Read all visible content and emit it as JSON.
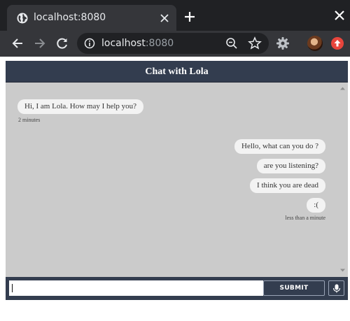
{
  "browser": {
    "tab_title": "localhost:8080",
    "url_host": "localhost",
    "url_port": ":8080",
    "icons": [
      "globe-icon",
      "close-icon",
      "plus-icon",
      "back-icon",
      "forward-icon",
      "reload-icon",
      "info-icon",
      "zoom-out-icon",
      "star-icon",
      "gear-icon",
      "avatar",
      "update-icon"
    ]
  },
  "chat": {
    "title": "Chat with Lola",
    "messages": [
      {
        "sender": "bot",
        "text": "Hi, I am Lola. How may I help you?",
        "time": "2 minutes"
      },
      {
        "sender": "user",
        "text": "Hello, what can you do ?"
      },
      {
        "sender": "user",
        "text": "are you listening?"
      },
      {
        "sender": "user",
        "text": "I think you are dead"
      },
      {
        "sender": "user",
        "text": ":(",
        "time": "less than a minute"
      }
    ],
    "input_value": "",
    "submit_label": "SUBMIT",
    "colors": {
      "header_bg": "#333d4f",
      "body_bg": "#cbcbcb",
      "bubble_bg": "#f3f3f3"
    }
  }
}
